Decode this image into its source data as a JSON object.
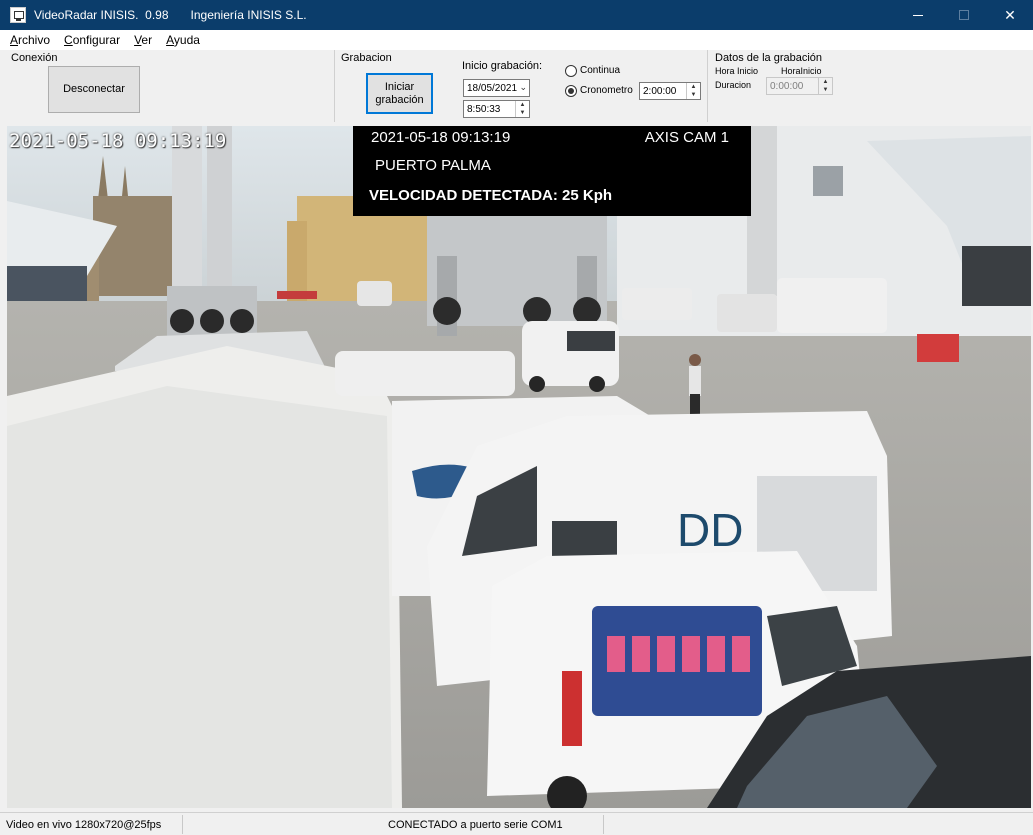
{
  "window": {
    "title": "VideoRadar INISIS.  0.98",
    "company": "Ingeniería INISIS S.L.",
    "controls": {
      "minimize": "—",
      "maximize": "☐",
      "close": "✕"
    }
  },
  "menu": {
    "items": [
      {
        "underline": "A",
        "rest": "rchivo"
      },
      {
        "underline": "C",
        "rest": "onfigurar"
      },
      {
        "underline": "V",
        "rest": "er"
      },
      {
        "underline": "A",
        "rest": "yuda"
      }
    ]
  },
  "conexion": {
    "label": "Conexión",
    "disconnect_button": "Desconectar"
  },
  "grabacion": {
    "label": "Grabacion",
    "start_button_line1": "Iniciar",
    "start_button_line2": "grabación",
    "start_label": "Inicio grabación:",
    "start_date": "18/05/2021",
    "start_time": "8:50:33",
    "mode_continua": "Continua",
    "mode_cronometro": "Cronometro",
    "selected_mode": "Cronometro",
    "cronometro_value": "2:00:00"
  },
  "datos": {
    "label": "Datos de la grabación",
    "hora_inicio_1": "Hora Inicio",
    "hora_inicio_2": "HoraInicio",
    "duracion_label": "Duracion",
    "duracion_value": "0:00:00"
  },
  "video": {
    "camera_timestamp": "2021-05-18 09:13:19",
    "overlay_timestamp": "2021-05-18   09:13:19",
    "overlay_camera": "AXIS CAM 1",
    "overlay_location": "PUERTO PALMA",
    "overlay_speed": "VELOCIDAD DETECTADA: 25 Kph"
  },
  "status": {
    "video_info": "Video en vivo 1280x720@25fps",
    "connection": "CONECTADO a puerto serie COM1"
  },
  "colors": {
    "titlebar": "#0b3d6b",
    "accent": "#0078d7",
    "overlay_bg": "#000000"
  }
}
